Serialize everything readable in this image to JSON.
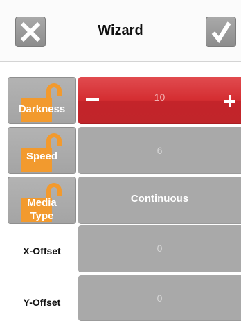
{
  "header": {
    "title": "Wizard",
    "cancel_icon": "close-icon",
    "confirm_icon": "checkmark-icon"
  },
  "settings": [
    {
      "label": "Darkness",
      "value": "10",
      "locked": true,
      "active": true,
      "stepper": {
        "minus": "−",
        "plus": "+"
      }
    },
    {
      "label": "Speed",
      "value": "6",
      "locked": true,
      "active": false
    },
    {
      "label": "Media Type",
      "value": "Continuous",
      "locked": true,
      "active": false
    },
    {
      "label": "X-Offset",
      "value": "0",
      "locked": false,
      "active": false
    },
    {
      "label": "Y-Offset",
      "value": "0",
      "locked": false,
      "active": false
    }
  ],
  "colors": {
    "active": "#d42d31",
    "lock": "#f29a2e",
    "button_gray": "#a9a9a9"
  }
}
